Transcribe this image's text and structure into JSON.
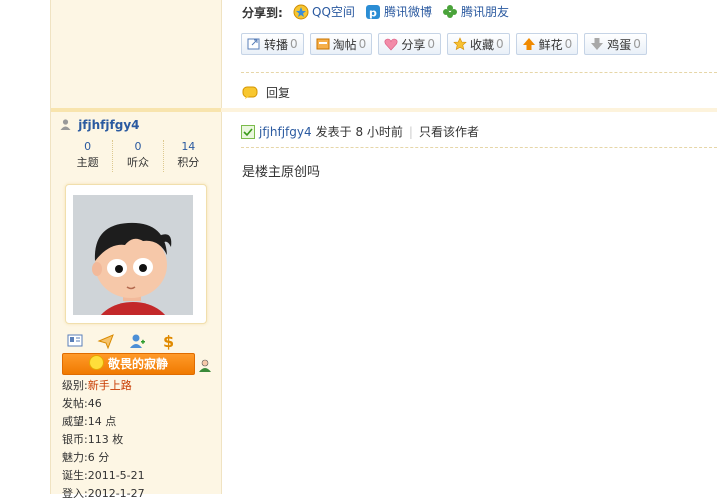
{
  "share": {
    "label": "分享到:",
    "items": [
      {
        "label": "QQ空间",
        "icon": "qzone-icon"
      },
      {
        "label": "腾讯微博",
        "icon": "tencent-weibo-icon"
      },
      {
        "label": "腾讯朋友",
        "icon": "tencent-friends-icon"
      }
    ]
  },
  "actions": [
    {
      "label": "转播",
      "count": "0",
      "icon": "forward-icon"
    },
    {
      "label": "淘帖",
      "count": "0",
      "icon": "collect-post-icon"
    },
    {
      "label": "分享",
      "count": "0",
      "icon": "heart-icon"
    },
    {
      "label": "收藏",
      "count": "0",
      "icon": "star-icon"
    },
    {
      "label": "鲜花",
      "count": "0",
      "icon": "arrow-up-icon"
    },
    {
      "label": "鸡蛋",
      "count": "0",
      "icon": "arrow-down-icon"
    }
  ],
  "reply": {
    "label": "回复"
  },
  "author": {
    "name": "jfjhfjfgy4",
    "stats": [
      {
        "num": "0",
        "label": "主题"
      },
      {
        "num": "0",
        "label": "听众"
      },
      {
        "num": "14",
        "label": "积分"
      }
    ],
    "rank_title": "敬畏的寂静",
    "profile": [
      {
        "key": "级别:",
        "value": "新手上路"
      },
      {
        "key": "发帖:",
        "value": "46"
      },
      {
        "key": "威望:",
        "value": "14 点"
      },
      {
        "key": "银币:",
        "value": "113 枚"
      },
      {
        "key": "魅力:",
        "value": "6 分"
      },
      {
        "key": "诞生:",
        "value": "2011-5-21"
      },
      {
        "key": "登入:",
        "value": "2012-1-27"
      }
    ]
  },
  "post": {
    "author": "jfjhfjfgy4",
    "time": "发表于 8 小时前",
    "only_author": "只看该作者",
    "content": "是楼主原创吗"
  }
}
